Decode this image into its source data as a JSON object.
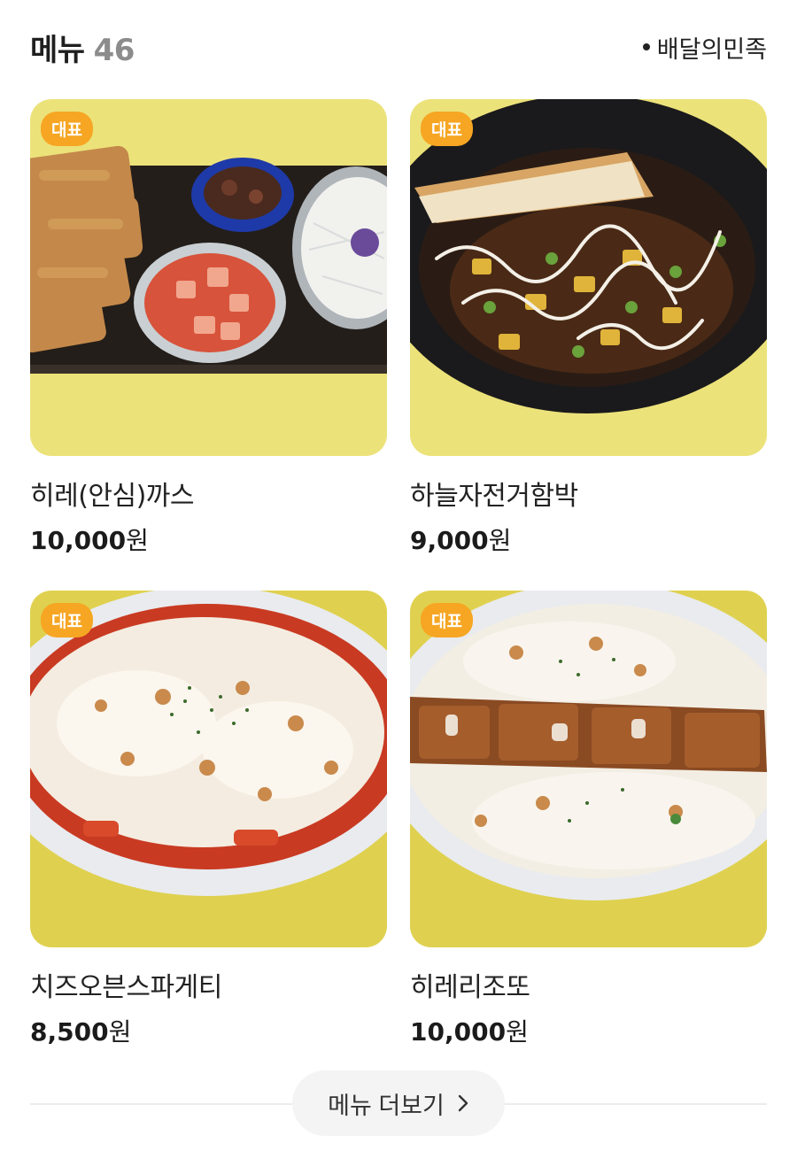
{
  "header": {
    "title": "메뉴",
    "count": "46",
    "source": "배달의민족"
  },
  "menu": [
    {
      "badge": "대표",
      "name": "히레(안심)까스",
      "price": "10,000",
      "unit": "원"
    },
    {
      "badge": "대표",
      "name": "하늘자전거함박",
      "price": "9,000",
      "unit": "원"
    },
    {
      "badge": "대표",
      "name": "치즈오븐스파게티",
      "price": "8,500",
      "unit": "원"
    },
    {
      "badge": "대표",
      "name": "히레리조또",
      "price": "10,000",
      "unit": "원"
    }
  ],
  "more": {
    "label": "메뉴 더보기",
    "icon": "chevron-right-icon"
  },
  "colors": {
    "badge": "#f6a623",
    "table": "#e8dc72",
    "source_dot": "#222222"
  }
}
